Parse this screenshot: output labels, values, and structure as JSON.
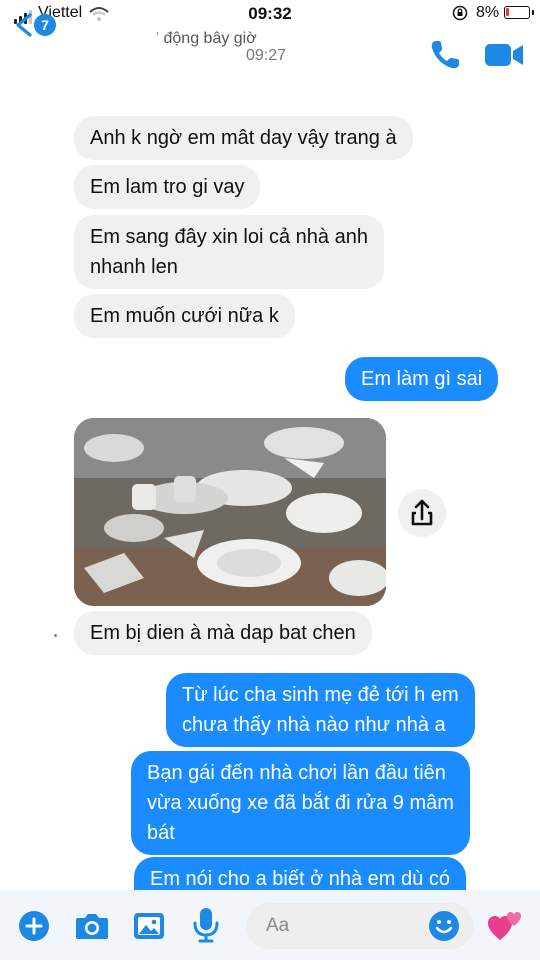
{
  "status_bar": {
    "carrier": "Viettel",
    "time": "09:32",
    "battery": "8%"
  },
  "header": {
    "back_badge": "7",
    "active_status": "động bây giờ",
    "timestamp": "09:27"
  },
  "messages": [
    {
      "side": "in",
      "text": "Anh k ngờ em mât day vậy trang à"
    },
    {
      "side": "in",
      "text": "Em lam tro gi vay"
    },
    {
      "side": "in",
      "lines": [
        "Em sang đây xin loi cả nhà anh",
        "nhanh len"
      ]
    },
    {
      "side": "in",
      "text": "Em muốn cưới nữa k"
    },
    {
      "side": "out",
      "text": "Em làm gì sai"
    },
    {
      "side": "in",
      "type": "photo",
      "icon": "broken-dishes-photo"
    },
    {
      "side": "in",
      "text": "Em bị dien à mà dap bat chen"
    },
    {
      "side": "out",
      "lines": [
        "Từ lúc cha sinh mẹ đẻ tới h em",
        "chưa thấy nhà nào như nhà a"
      ]
    },
    {
      "side": "out",
      "lines": [
        "Bạn gái đến nhà chơi lần đầu tiên",
        "vừa xuống xe đã bắt đi rửa 9 mâm",
        "bát"
      ]
    },
    {
      "side": "out",
      "text": "Em nói cho a biết ở nhà em dù có"
    }
  ],
  "composer": {
    "placeholder": "Aa"
  },
  "colors": {
    "accent": "#1a8cff",
    "incoming_bubble": "#f0f0f0",
    "icon_blue": "#1e88e5"
  },
  "icons": [
    "back-chevron-icon",
    "phone-icon",
    "video-camera-icon",
    "share-icon",
    "plus-icon",
    "camera-icon",
    "gallery-icon",
    "microphone-icon",
    "emoji-icon",
    "hearts-icon"
  ]
}
